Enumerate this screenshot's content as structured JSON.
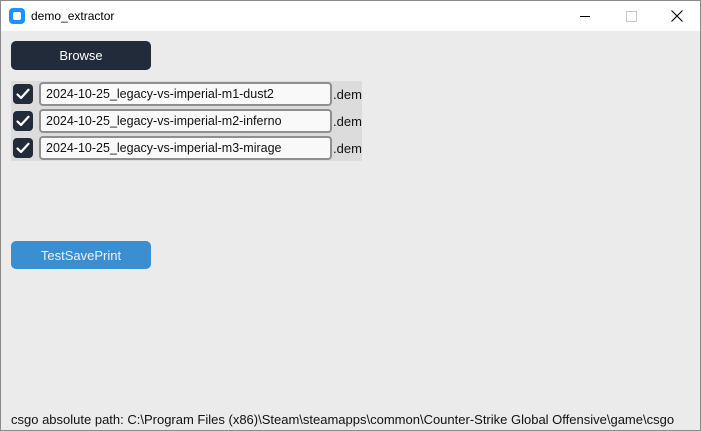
{
  "window": {
    "title": "demo_extractor",
    "controls": {
      "minimize": "minimize",
      "maximize": "maximize",
      "close": "✕"
    }
  },
  "toolbar": {
    "browse_label": "Browse"
  },
  "files": [
    {
      "name": "2024-10-25_legacy-vs-imperial-m1-dust2",
      "extension": ".dem",
      "checked": true
    },
    {
      "name": "2024-10-25_legacy-vs-imperial-m2-inferno",
      "extension": ".dem",
      "checked": true
    },
    {
      "name": "2024-10-25_legacy-vs-imperial-m3-mirage",
      "extension": ".dem",
      "checked": true
    }
  ],
  "actions": {
    "test_label": "TestSavePrint"
  },
  "status": {
    "csgo_path": "csgo absolute path: C:\\Program Files (x86)\\Steam\\steamapps\\common\\Counter-Strike Global Offensive\\game\\csgo"
  },
  "colors": {
    "dark_button": "#222b3a",
    "accent_button": "#3b8ed0",
    "background": "#ebebeb"
  }
}
